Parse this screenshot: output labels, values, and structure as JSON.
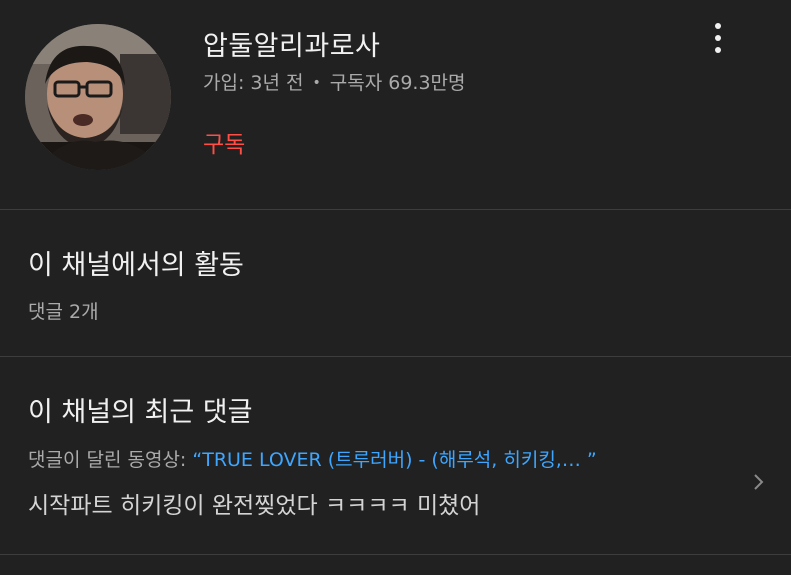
{
  "channel": {
    "name": "압둘알리과로사",
    "joined": "가입: 3년 전",
    "separator": "•",
    "subscribers": "구독자 69.3만명",
    "subscribe_label": "구독"
  },
  "activity": {
    "title": "이 채널에서의 활동",
    "comment_count": "댓글 2개"
  },
  "recent_comment": {
    "title": "이 채널의 최근 댓글",
    "video_prefix": "댓글이 달린 동영상: ",
    "video_title": "“TRUE LOVER (트루러버) - (해루석, 히키킹,…  ”",
    "text": "시작파트 히키킹이 완전찢었다 ㅋㅋㅋㅋ 미쳤어"
  },
  "colors": {
    "background": "#212121",
    "subscribe": "#ff4e45",
    "link": "#3ea6ff"
  },
  "icons": {
    "more": "more-vertical-icon",
    "chevron": "chevron-right-icon"
  }
}
